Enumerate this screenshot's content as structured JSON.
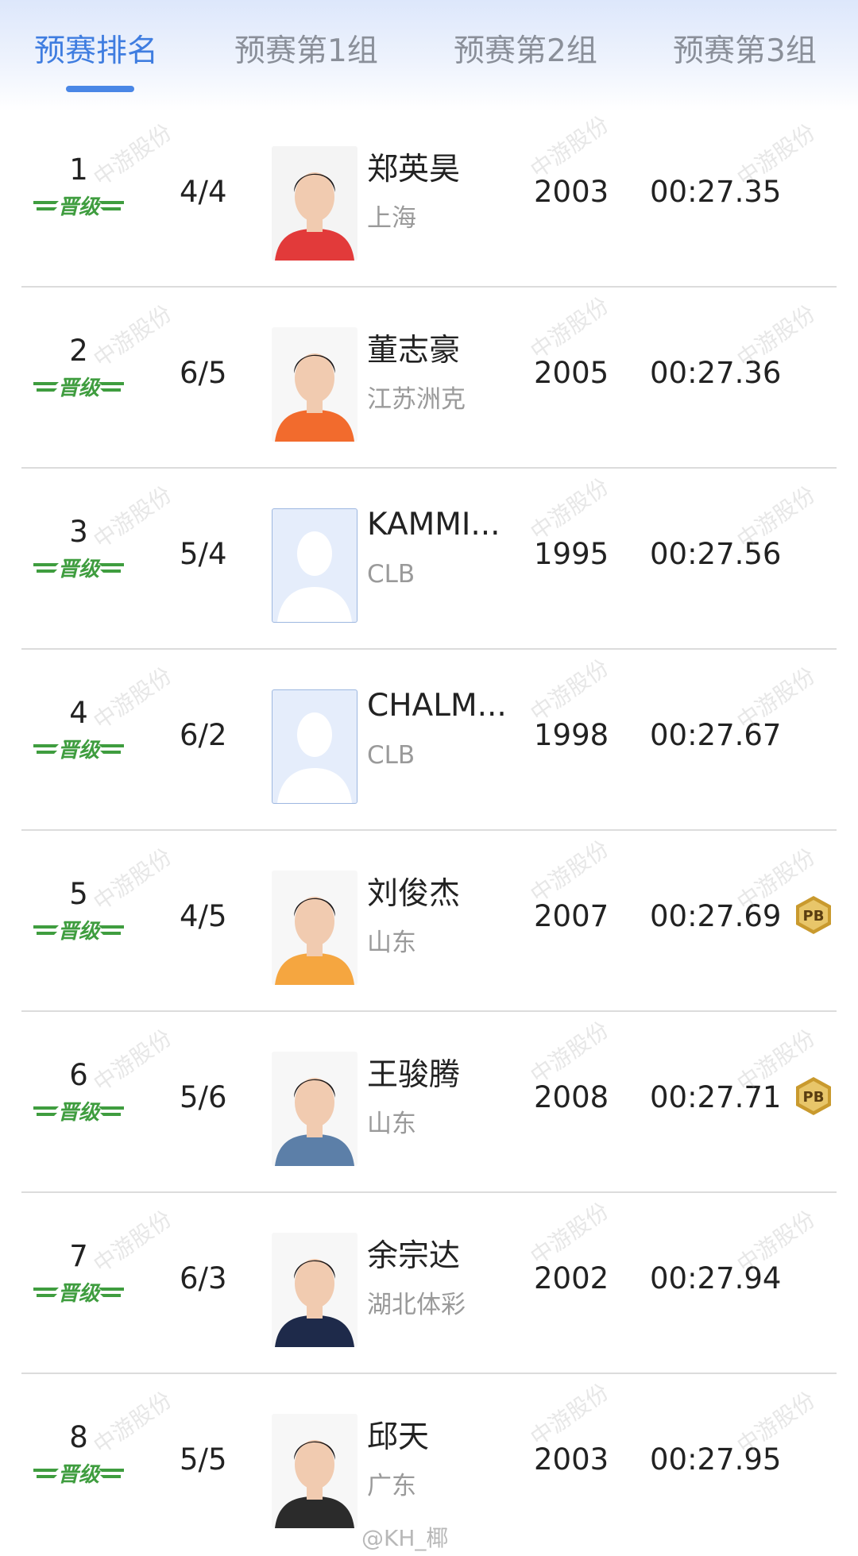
{
  "tabs": [
    {
      "label": "预赛排名",
      "active": true
    },
    {
      "label": "预赛第1组",
      "active": false
    },
    {
      "label": "预赛第2组",
      "active": false
    },
    {
      "label": "预赛第3组",
      "active": false
    }
  ],
  "qualified_label": "晋级",
  "pb_label": "PB",
  "watermark": "中游股份",
  "credit": "@KH_椰",
  "rows": [
    {
      "rank": "1",
      "lane": "4/4",
      "name": "郑英昊",
      "team": "上海",
      "year": "2003",
      "time": "00:27.35",
      "pb": false
    },
    {
      "rank": "2",
      "lane": "6/5",
      "name": "董志豪",
      "team": "江苏洲克",
      "year": "2005",
      "time": "00:27.36",
      "pb": false
    },
    {
      "rank": "3",
      "lane": "5/4",
      "name": "KAMMI...",
      "team": "CLB",
      "year": "1995",
      "time": "00:27.56",
      "pb": false
    },
    {
      "rank": "4",
      "lane": "6/2",
      "name": "CHALM...",
      "team": "CLB",
      "year": "1998",
      "time": "00:27.67",
      "pb": false
    },
    {
      "rank": "5",
      "lane": "4/5",
      "name": "刘俊杰",
      "team": "山东",
      "year": "2007",
      "time": "00:27.69",
      "pb": true
    },
    {
      "rank": "6",
      "lane": "5/6",
      "name": "王骏腾",
      "team": "山东",
      "year": "2008",
      "time": "00:27.71",
      "pb": true
    },
    {
      "rank": "7",
      "lane": "6/3",
      "name": "余宗达",
      "team": "湖北体彩",
      "year": "2002",
      "time": "00:27.94",
      "pb": false
    },
    {
      "rank": "8",
      "lane": "5/5",
      "name": "邱天",
      "team": "广东",
      "year": "2003",
      "time": "00:27.95",
      "pb": false
    }
  ],
  "colors": {
    "accent": "#3f7de0",
    "qualified": "#3f9d3f",
    "pb_gold": "#c99a2e"
  }
}
